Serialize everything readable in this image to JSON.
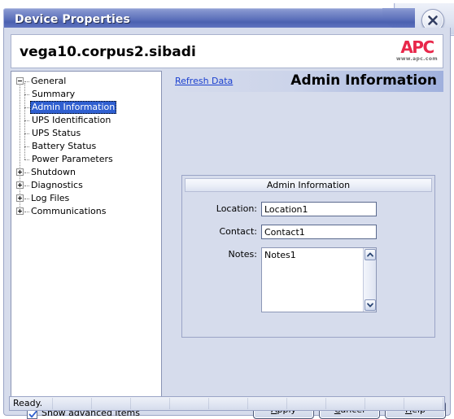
{
  "window": {
    "title": "Device Properties",
    "close_icon": "close-x-icon"
  },
  "header": {
    "hostname": "vega10.corpus2.sibadi",
    "logo_mark": "APC",
    "logo_url": "www.apc.com"
  },
  "tree": {
    "nodes": [
      {
        "label": "General",
        "level": 0,
        "expander": "minus",
        "selected": false
      },
      {
        "label": "Summary",
        "level": 1,
        "expander": "none",
        "selected": false
      },
      {
        "label": "Admin Information",
        "level": 1,
        "expander": "none",
        "selected": true
      },
      {
        "label": "UPS Identification",
        "level": 1,
        "expander": "none",
        "selected": false
      },
      {
        "label": "UPS Status",
        "level": 1,
        "expander": "none",
        "selected": false
      },
      {
        "label": "Battery Status",
        "level": 1,
        "expander": "none",
        "selected": false
      },
      {
        "label": "Power Parameters",
        "level": 1,
        "expander": "none",
        "selected": false
      },
      {
        "label": "Shutdown",
        "level": 0,
        "expander": "plus",
        "selected": false
      },
      {
        "label": "Diagnostics",
        "level": 0,
        "expander": "plus",
        "selected": false
      },
      {
        "label": "Log Files",
        "level": 0,
        "expander": "plus",
        "selected": false
      },
      {
        "label": "Communications",
        "level": 0,
        "expander": "plus",
        "selected": false
      }
    ]
  },
  "content": {
    "refresh_link": "Refresh Data",
    "title": "Admin Information",
    "groupbox": {
      "title": "Admin Information",
      "fields": {
        "location_label": "Location:",
        "location_value": "Location1",
        "contact_label": "Contact:",
        "contact_value": "Contact1",
        "notes_label": "Notes:",
        "notes_value": "Notes1"
      },
      "scroll_up_icon": "chevron-up-icon",
      "scroll_down_icon": "chevron-down-icon"
    }
  },
  "footer": {
    "show_advanced_label": "Show advanced items",
    "show_advanced_checked": true,
    "check_icon": "checkmark-icon",
    "buttons": [
      {
        "label": "Apply",
        "accel": "A"
      },
      {
        "label": "Cancel",
        "accel": "C"
      },
      {
        "label": "Help",
        "accel": "H"
      }
    ]
  },
  "statusbar": {
    "text": "Ready."
  },
  "colors": {
    "dialog_background": "#d6dcec",
    "titlebar_blue": "#5d71bb",
    "selection_blue": "#2f5fd0",
    "link_blue": "#1a3fcf",
    "logo_red": "#e8274a",
    "panel_white": "#ffffff"
  }
}
